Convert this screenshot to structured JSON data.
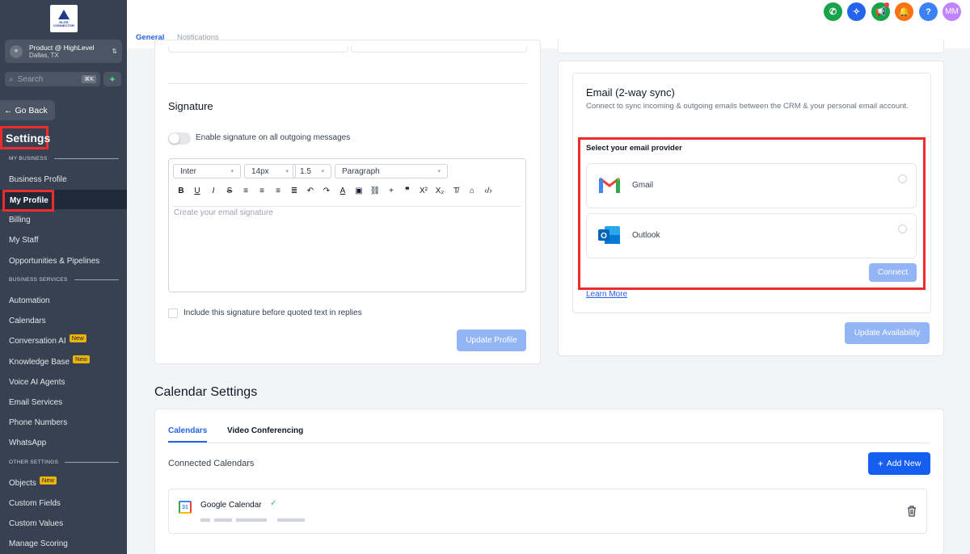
{
  "sidebar": {
    "logo_text": "ELITE CONNECTOR",
    "account": {
      "name": "Product @ HighLevel",
      "location": "Dallas, TX"
    },
    "search": {
      "placeholder": "Search",
      "shortcut": "⌘K"
    },
    "go_back": "Go Back",
    "title": "Settings",
    "sections": {
      "my_business": "MY BUSINESS",
      "business_services": "BUSINESS SERVICES",
      "other_settings": "OTHER SETTINGS"
    },
    "items": {
      "business_profile": "Business Profile",
      "my_profile": "My Profile",
      "billing": "Billing",
      "my_staff": "My Staff",
      "opportunities": "Opportunities & Pipelines",
      "automation": "Automation",
      "calendars": "Calendars",
      "conversation_ai": "Conversation AI",
      "knowledge_base": "Knowledge Base",
      "voice_ai": "Voice AI Agents",
      "email_services": "Email Services",
      "phone_numbers": "Phone Numbers",
      "whatsapp": "WhatsApp",
      "objects": "Objects",
      "custom_fields": "Custom Fields",
      "custom_values": "Custom Values",
      "manage_scoring": "Manage Scoring"
    },
    "badge_new": "New"
  },
  "header": {
    "tabs": {
      "general": "General",
      "notifications": "Notifications"
    },
    "avatar": "MM",
    "help": "?"
  },
  "signature": {
    "title": "Signature",
    "toggle_label": "Enable signature on all outgoing messages",
    "font": "Inter",
    "size": "14px",
    "line_height": "1.5",
    "block": "Paragraph",
    "placeholder": "Create your email signature",
    "include_label": "Include this signature before quoted text in replies",
    "update_button": "Update Profile"
  },
  "email_sync": {
    "title": "Email (2-way sync)",
    "description": "Connect to sync incoming & outgoing emails between the CRM & your personal email account.",
    "provider_label": "Select your email provider",
    "providers": [
      "Gmail",
      "Outlook"
    ],
    "connect_button": "Connect",
    "learn_more": "Learn More",
    "update_availability": "Update Availability"
  },
  "calendar_settings": {
    "title": "Calendar Settings",
    "tabs": [
      "Calendars",
      "Video Conferencing"
    ],
    "connected_label": "Connected Calendars",
    "add_button": "Add New",
    "calendar_name": "Google Calendar",
    "calendar_icon_num": "31"
  },
  "colors": {
    "accent": "#155eef",
    "highlight": "#ef2b2b",
    "sidebar_bg": "#374151",
    "badge": "#eab308"
  }
}
